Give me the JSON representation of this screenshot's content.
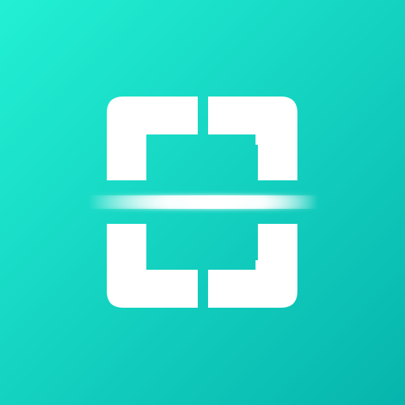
{
  "icon": {
    "name": "scanner-app-icon",
    "symbol": "scan-frame-icon",
    "colors": {
      "gradient_start": "#22f0d4",
      "gradient_end": "#06b5ad",
      "glyph": "#ffffff",
      "scan_line": "#ffffff"
    }
  }
}
